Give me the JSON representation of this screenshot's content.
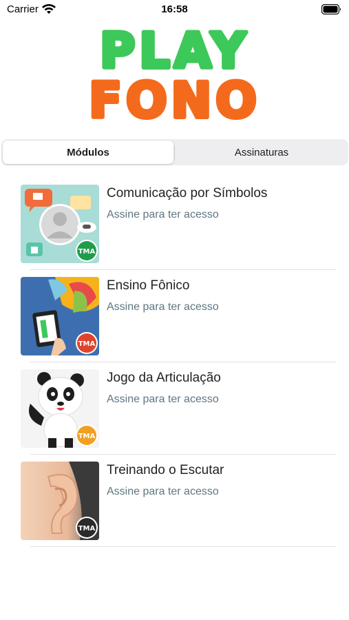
{
  "status_bar": {
    "carrier": "Carrier",
    "time": "16:58",
    "wifi_icon": "wifi-icon",
    "battery_icon": "battery-icon"
  },
  "logo": {
    "line1": "PLAY",
    "line2": "FONO",
    "line1_color": "#3dc85a",
    "line2_color": "#f46a1c"
  },
  "tabs": [
    {
      "label": "Módulos",
      "selected": true
    },
    {
      "label": "Assinaturas",
      "selected": false
    }
  ],
  "modules": [
    {
      "title": "Comunicação por Símbolos",
      "subtitle": "Assine para ter acesso",
      "badge": "TMA",
      "badge_color": "#1f9d4a"
    },
    {
      "title": "Ensino Fônico",
      "subtitle": "Assine para ter acesso",
      "badge": "TMA",
      "badge_color": "#e0432b"
    },
    {
      "title": "Jogo da Articulação",
      "subtitle": "Assine para ter acesso",
      "badge": "TMA",
      "badge_color": "#f0a020"
    },
    {
      "title": "Treinando o Escutar",
      "subtitle": "Assine para ter acesso",
      "badge": "TMA",
      "badge_color": "#2a2a2a"
    }
  ]
}
